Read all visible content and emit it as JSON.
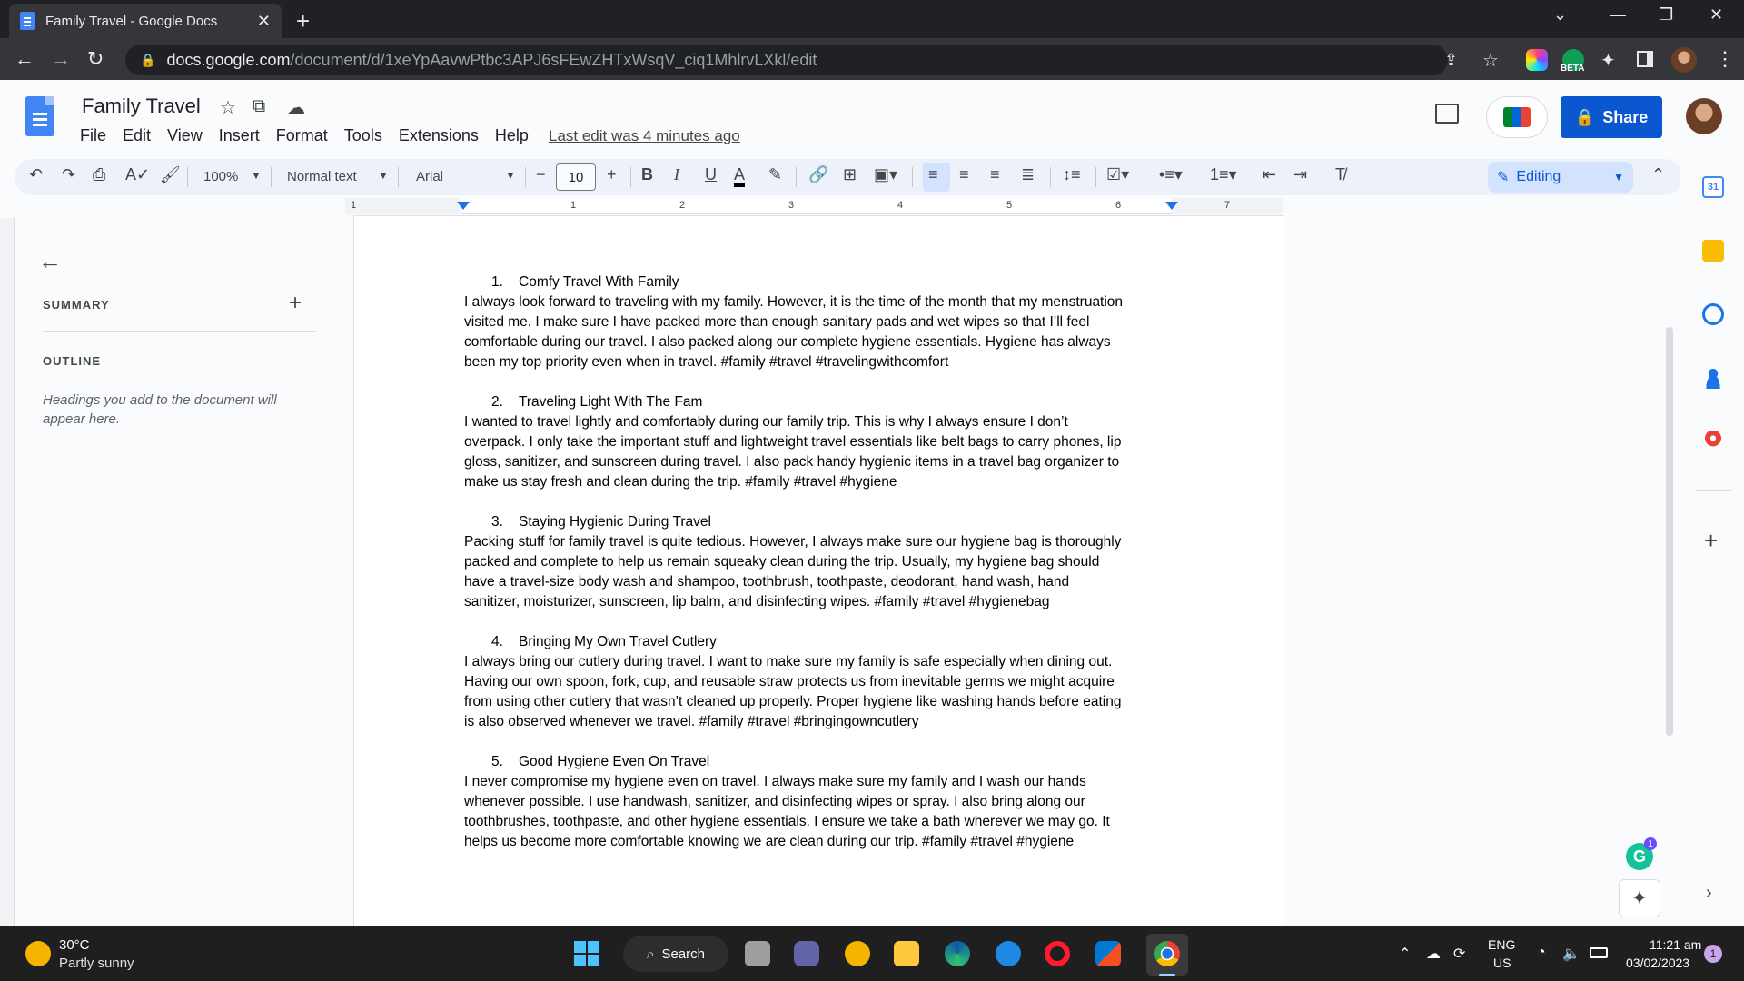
{
  "browser": {
    "tab_title": "Family Travel - Google Docs",
    "url_host": "docs.google.com",
    "url_path": "/document/d/1xeYpAavwPtbc3APJ6sFEwZHTxWsqV_ciq1MhlrvLXkl/edit",
    "ext_beta_label": "BETA"
  },
  "docs": {
    "title": "Family Travel",
    "menu": [
      "File",
      "Edit",
      "View",
      "Insert",
      "Format",
      "Tools",
      "Extensions",
      "Help"
    ],
    "last_edit": "Last edit was 4 minutes ago",
    "share_label": "Share",
    "toolbar": {
      "zoom": "100%",
      "style": "Normal text",
      "font": "Arial",
      "font_size": "10",
      "mode": "Editing"
    },
    "ruler_numbers": [
      "1",
      "1",
      "2",
      "3",
      "4",
      "5",
      "6",
      "7"
    ]
  },
  "outline": {
    "summary_label": "SUMMARY",
    "outline_label": "OUTLINE",
    "hint": "Headings you add to the document will appear here."
  },
  "document": {
    "sections": [
      {
        "num": "1.",
        "heading": "Comfy Travel With Family",
        "lines": [
          "I always look forward to traveling with my family. However, it is the time of the month that my menstruation",
          "visited me. I make sure I have packed more than enough sanitary pads and wet wipes so that I’ll feel",
          "comfortable during our travel. I also packed along our complete hygiene essentials. Hygiene has always",
          "been my top priority even when in travel. #family #travel #travelingwithcomfort"
        ]
      },
      {
        "num": "2.",
        "heading": "Traveling Light With The Fam",
        "lines": [
          "I wanted to travel lightly and comfortably during our family trip. This is why I always ensure I don’t",
          "overpack. I only take the important stuff and lightweight travel essentials like belt bags to carry phones, lip",
          "gloss, sanitizer, and sunscreen during travel. I also pack handy hygienic items in a travel bag organizer to",
          "make us stay fresh and clean during the trip. #family #travel #hygiene"
        ]
      },
      {
        "num": "3.",
        "heading": "Staying Hygienic During Travel",
        "lines": [
          "Packing stuff for family travel is quite tedious. However, I always make sure our hygiene bag is thoroughly",
          "packed and complete to help us remain squeaky clean during the trip. Usually, my hygiene bag should",
          "have a travel-size body wash and shampoo, toothbrush, toothpaste, deodorant, hand wash, hand",
          "sanitizer, moisturizer, sunscreen, lip balm, and disinfecting wipes. #family #travel #hygienebag"
        ]
      },
      {
        "num": "4.",
        "heading": "Bringing My Own Travel Cutlery",
        "lines": [
          "I always bring our cutlery during travel. I want to make sure my family is safe especially when dining out.",
          "Having our own spoon, fork, cup, and reusable straw protects us from inevitable germs we might acquire",
          "from using other cutlery that wasn’t cleaned up properly. Proper hygiene like washing hands before eating",
          "is also observed whenever we travel. #family #travel #bringingowncutlery"
        ]
      },
      {
        "num": "5.",
        "heading": "Good Hygiene Even On Travel",
        "lines": [
          "I never compromise my hygiene even on travel. I always make sure my family and I wash our hands",
          "whenever possible. I use handwash, sanitizer, and disinfecting wipes or spray. I also bring along our",
          "toothbrushes, toothpaste, and other hygiene essentials. I ensure we take a bath wherever we may go. It",
          "helps us become more comfortable knowing we are clean during our trip. #family #travel #hygiene"
        ]
      }
    ]
  },
  "sidepanel": {
    "calendar_day": "31",
    "grammarly_count": "1"
  },
  "taskbar": {
    "temp": "30°C",
    "condition": "Partly sunny",
    "search_label": "Search",
    "lang_top": "ENG",
    "lang_bottom": "US",
    "time": "11:21 am",
    "date": "03/02/2023",
    "notification_count": "1"
  }
}
